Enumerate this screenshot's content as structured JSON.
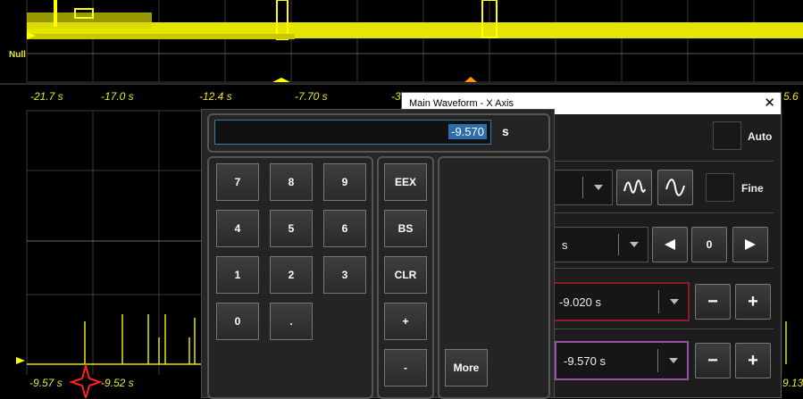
{
  "scope": {
    "top_time_labels": [
      "-21.7 s",
      "-17.0 s",
      "-12.4 s",
      "-7.70 s",
      "-3",
      "5.6"
    ],
    "ground_label": "Null",
    "bottom_time_labels": [
      "-9.57 s",
      "-9.52 s",
      "9.13"
    ],
    "trace_color": "#ffff00",
    "marker_color": "#ff2020"
  },
  "dialog": {
    "title": "Main Waveform - X Axis",
    "close_glyph": "✕",
    "auto_label": "Auto",
    "fine_label": "Fine",
    "timebase_value": "s",
    "position_value": "0",
    "cursor1_value": "-9.020 s",
    "cursor1_color": "#8b1a2a",
    "cursor2_value": "-9.570 s",
    "cursor2_color": "#9b4fa8",
    "minus": "−",
    "plus": "+"
  },
  "keypad": {
    "entry_value": "-9.570",
    "entry_unit": "s",
    "digits": [
      "7",
      "8",
      "9",
      "4",
      "5",
      "6",
      "1",
      "2",
      "3",
      "0",
      "."
    ],
    "functions": [
      "EEX",
      "BS",
      "CLR",
      "+",
      "-"
    ],
    "more_label": "More"
  }
}
